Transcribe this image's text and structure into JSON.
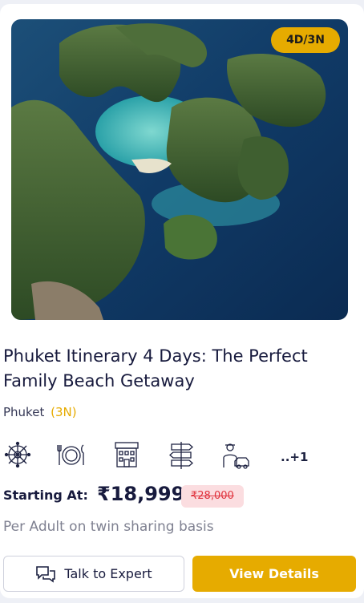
{
  "package": {
    "duration_badge": "4D/3N",
    "title": "Phuket Itinerary 4 Days: The Perfect Family Beach Getaway",
    "location": "Phuket",
    "location_nights": "(3N)",
    "amenities": [
      "sightseeing-icon",
      "meals-icon",
      "hotel-icon",
      "signpost-icon",
      "transfer-icon"
    ],
    "amenities_more": "..+1",
    "starting_label": "Starting At:",
    "price": "₹18,999",
    "original_price": "₹28,000",
    "basis": "Per Adult on twin sharing basis"
  },
  "actions": {
    "talk_label": "Talk to Expert",
    "details_label": "View Details"
  },
  "colors": {
    "accent": "#e6ab00",
    "title": "#171a3d",
    "discount_bg": "#fbdde0",
    "discount_text": "#e0333d",
    "muted": "#7f8191"
  }
}
